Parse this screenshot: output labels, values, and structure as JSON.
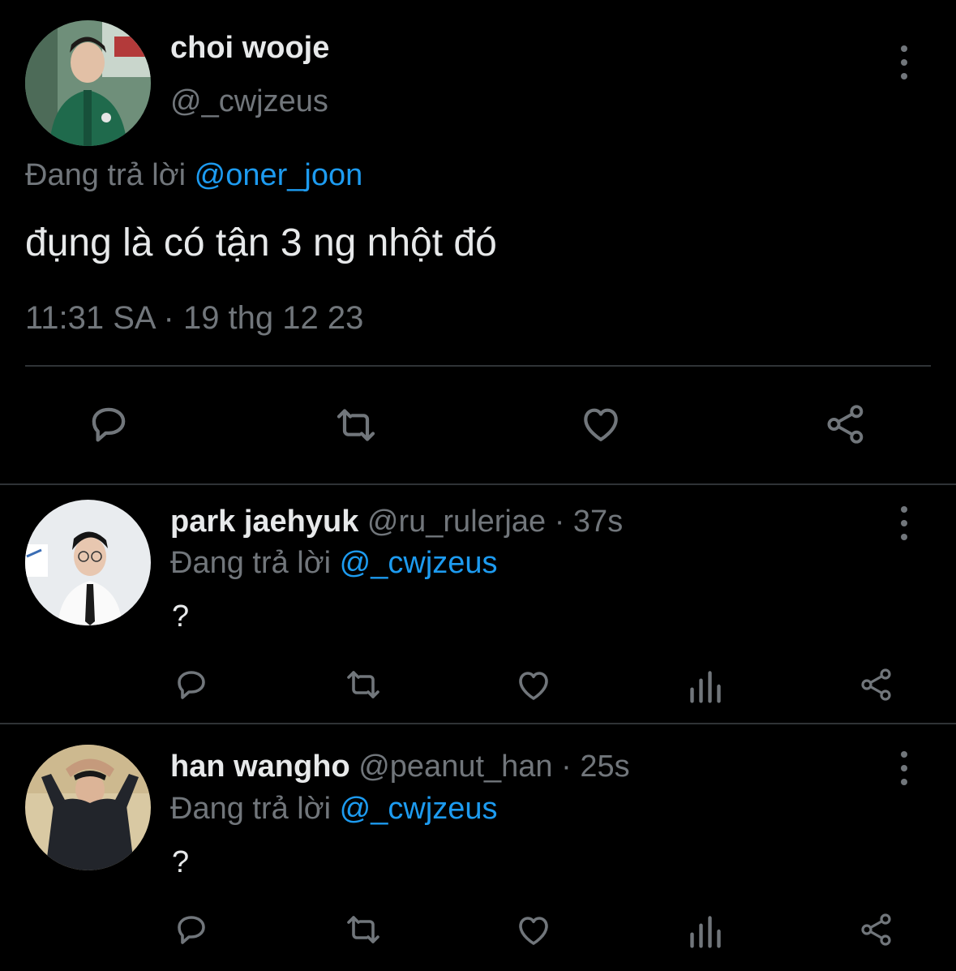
{
  "main_tweet": {
    "author_name": "choi wooje",
    "handle": "@_cwjzeus",
    "reply_prefix": "Đang trả lời",
    "reply_to": "@oner_joon",
    "text": "đụng là có tận 3 ng nhột đó",
    "timestamp": "11:31 SA · 19 thg 12 23",
    "actions": [
      "reply-icon",
      "retweet-icon",
      "like-icon",
      "share-icon"
    ]
  },
  "replies": [
    {
      "author_name": "park jaehyuk",
      "handle": "@ru_rulerjae",
      "separator": " · ",
      "time": "37s",
      "reply_prefix": "Đang trả lời",
      "reply_to": "@_cwjzeus",
      "text": "?",
      "actions": [
        "reply-icon",
        "retweet-icon",
        "like-icon",
        "analytics-icon",
        "share-icon"
      ]
    },
    {
      "author_name": "han wangho",
      "handle": "@peanut_han",
      "separator": " · ",
      "time": "25s",
      "reply_prefix": "Đang trả lời",
      "reply_to": "@_cwjzeus",
      "text": "?",
      "actions": [
        "reply-icon",
        "retweet-icon",
        "like-icon",
        "analytics-icon",
        "share-icon"
      ]
    }
  ],
  "colors": {
    "background": "#000000",
    "primary_text": "#e7e9ea",
    "secondary_text": "#71767b",
    "accent": "#1d9bf0",
    "divider": "#2f3336"
  }
}
